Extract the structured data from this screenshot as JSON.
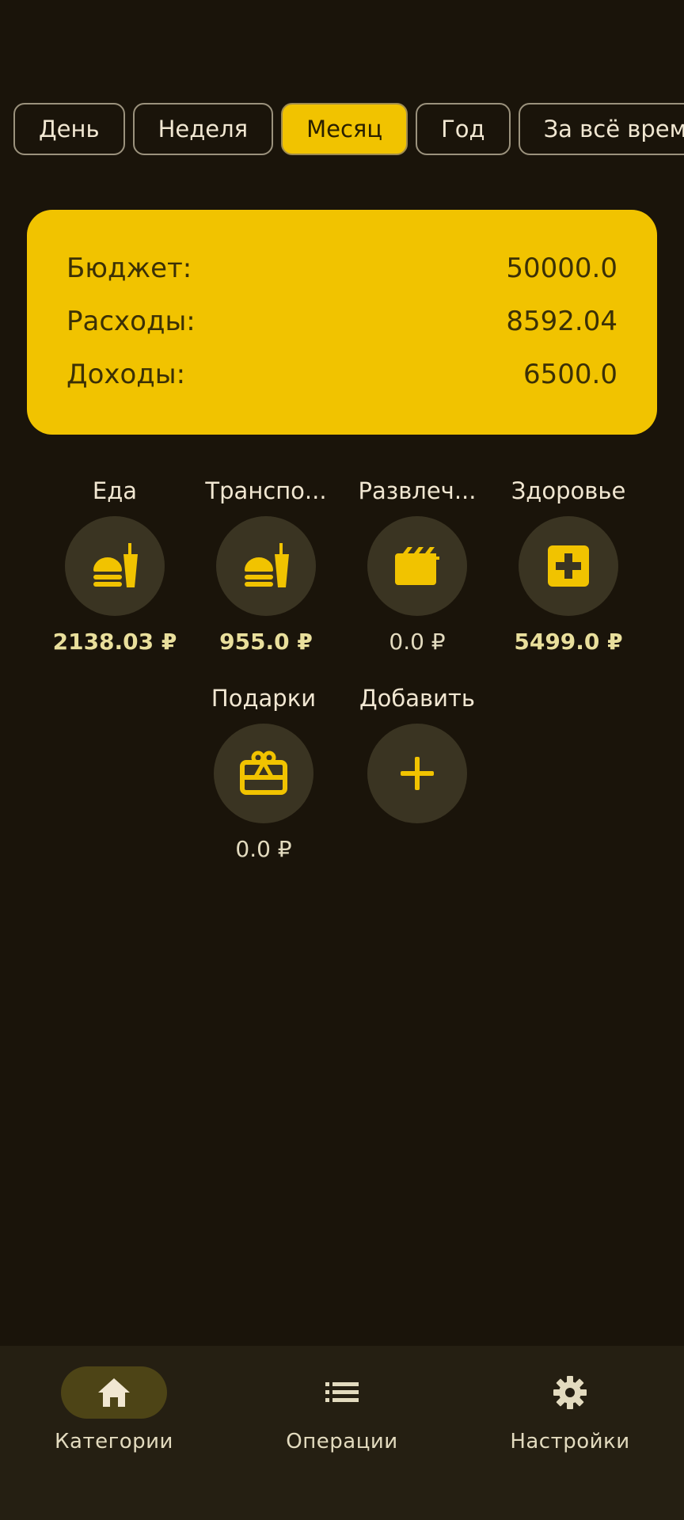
{
  "periods": [
    "День",
    "Неделя",
    "Месяц",
    "Год",
    "За всё врем"
  ],
  "active_period": "Месяц",
  "summary": {
    "budget_label": "Бюджет:",
    "budget_value": "50000.0",
    "expenses_label": "Расходы:",
    "expenses_value": "8592.04",
    "income_label": "Доходы:",
    "income_value": "6500.0"
  },
  "categories": [
    {
      "name": "Еда",
      "amount": "2138.03 ₽",
      "icon": "fastfood-icon"
    },
    {
      "name": "Транспо...",
      "amount": "955.0 ₽",
      "icon": "fastfood-icon"
    },
    {
      "name": "Развлеч...",
      "amount": "0.0 ₽",
      "icon": "movie-icon"
    },
    {
      "name": "Здоровье",
      "amount": "5499.0 ₽",
      "icon": "medical-icon"
    },
    {
      "name": "Подарки",
      "amount": "0.0 ₽",
      "icon": "gift-card-icon"
    },
    {
      "name": "Добавить",
      "icon": "plus-icon"
    }
  ],
  "nav": [
    {
      "label": "Категории",
      "icon": "home-icon"
    },
    {
      "label": "Операции",
      "icon": "list-icon"
    },
    {
      "label": "Настройки",
      "icon": "gear-icon"
    }
  ],
  "colors": {
    "background": "#1a140a",
    "accent": "#f1c300",
    "circle": "#3a3422",
    "nav_bar": "#251f12",
    "nav_active_pill": "#4d4416"
  }
}
